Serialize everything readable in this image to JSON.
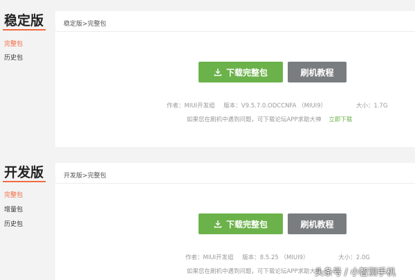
{
  "stable": {
    "title": "稳定版",
    "sidebar": [
      {
        "label": "完整包",
        "active": true
      },
      {
        "label": "历史包",
        "active": false
      }
    ],
    "breadcrumb": {
      "parent": "稳定版",
      "separator": ">",
      "current": "完整包"
    },
    "download_label": "下载完整包",
    "tutorial_label": "刷机教程",
    "meta": {
      "author": "作者：MIUI开发组",
      "version": "版本：V9.5.7.0.ODCCNFA （MIUI9）",
      "size": "大小：1.7G"
    },
    "help": {
      "text": "如果您在刷机中遇到问题，可下载论坛APP求助大神",
      "link": "立即下载"
    }
  },
  "dev": {
    "title": "开发版",
    "sidebar": [
      {
        "label": "完整包",
        "active": true
      },
      {
        "label": "增量包",
        "active": false
      },
      {
        "label": "历史包",
        "active": false
      }
    ],
    "breadcrumb": {
      "parent": "开发版",
      "separator": ">",
      "current": "完整包"
    },
    "download_label": "下载完整包",
    "tutorial_label": "刷机教程",
    "meta": {
      "author": "作者：MIUI开发组",
      "version": "版本：8.5.25 （MIUI9）",
      "size": "大小：2.0G"
    },
    "help": {
      "text": "如果您在刷机中遇到问题，可下载论坛APP求助大神"
    }
  },
  "watermark": "头条号 / 小智测手机",
  "colors": {
    "accent": "#f26a3f",
    "download": "#6bb24a",
    "tutorial": "#7a7d80"
  }
}
